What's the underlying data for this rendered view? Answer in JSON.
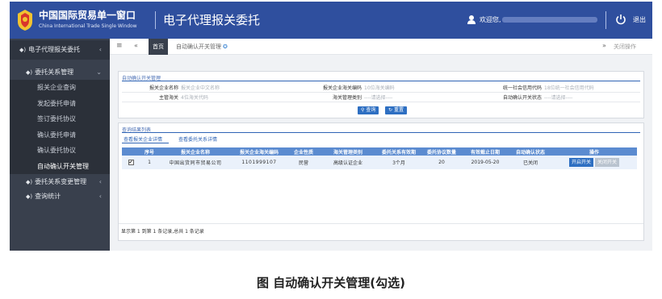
{
  "header": {
    "brand_cn": "中国国际贸易单一窗口",
    "brand_en": "China International Trade Single Window",
    "system_title": "电子代理报关委托",
    "welcome": "欢迎您,",
    "logout": "退出",
    "colors": {
      "topbar": "#2f4f9e",
      "sidebar": "#39404d",
      "accent": "#2e6fc2"
    }
  },
  "sidebar": {
    "top": "电子代理报关委托",
    "group1": "委托关系管理",
    "items": [
      "报关企业查询",
      "发起委托申请",
      "签订委托协议",
      "确认委托申请",
      "确认委托协议",
      "自动确认开关管理"
    ],
    "group2": "委托关系变更管理",
    "group3": "查询统计"
  },
  "tabs": {
    "home": "首页",
    "current": "自动确认开关管理",
    "close_ops": "关闭操作"
  },
  "query": {
    "title": "自动确认开关管理",
    "row1": [
      {
        "label": "报关企业名称",
        "placeholder": "报关企业中文名称"
      },
      {
        "label": "报关企业海关编码",
        "placeholder": "10位海关编码"
      },
      {
        "label": "统一社会信用代码",
        "placeholder": "18位统一社会信用代码"
      }
    ],
    "row2": [
      {
        "label": "主管海关",
        "placeholder": "4位海关代码"
      },
      {
        "label": "海关管理类别",
        "placeholder": "----请选择----"
      },
      {
        "label": "自动确认开关状态",
        "placeholder": "----请选择----"
      }
    ],
    "search_button": "查询",
    "reset_button": "重置"
  },
  "results": {
    "title": "查询结果列表",
    "tab1": "查看报关企业详情",
    "tab2": "查看委托关系详情",
    "columns": [
      "",
      "序号",
      "报关企业名称",
      "报关企业海关编码",
      "企业性质",
      "海关管理类别",
      "委托关系有效期",
      "委托协议数量",
      "有效截止日期",
      "自动确认状态",
      "操作"
    ],
    "rows": [
      {
        "checked": true,
        "no": "1",
        "name": "中国出货同市贸易公司",
        "code": "1101999107",
        "nature": "民营",
        "category": "高级认证企业",
        "validity": "3个月",
        "count": "20",
        "deadline": "2019-05-20",
        "status": "已关闭",
        "op_on": "开启开关",
        "op_off": "关闭开关"
      }
    ],
    "pager": "显示第 1 到第 1 条记录,总共 1 条记录"
  },
  "caption": "图 自动确认开关管理(勾选)"
}
